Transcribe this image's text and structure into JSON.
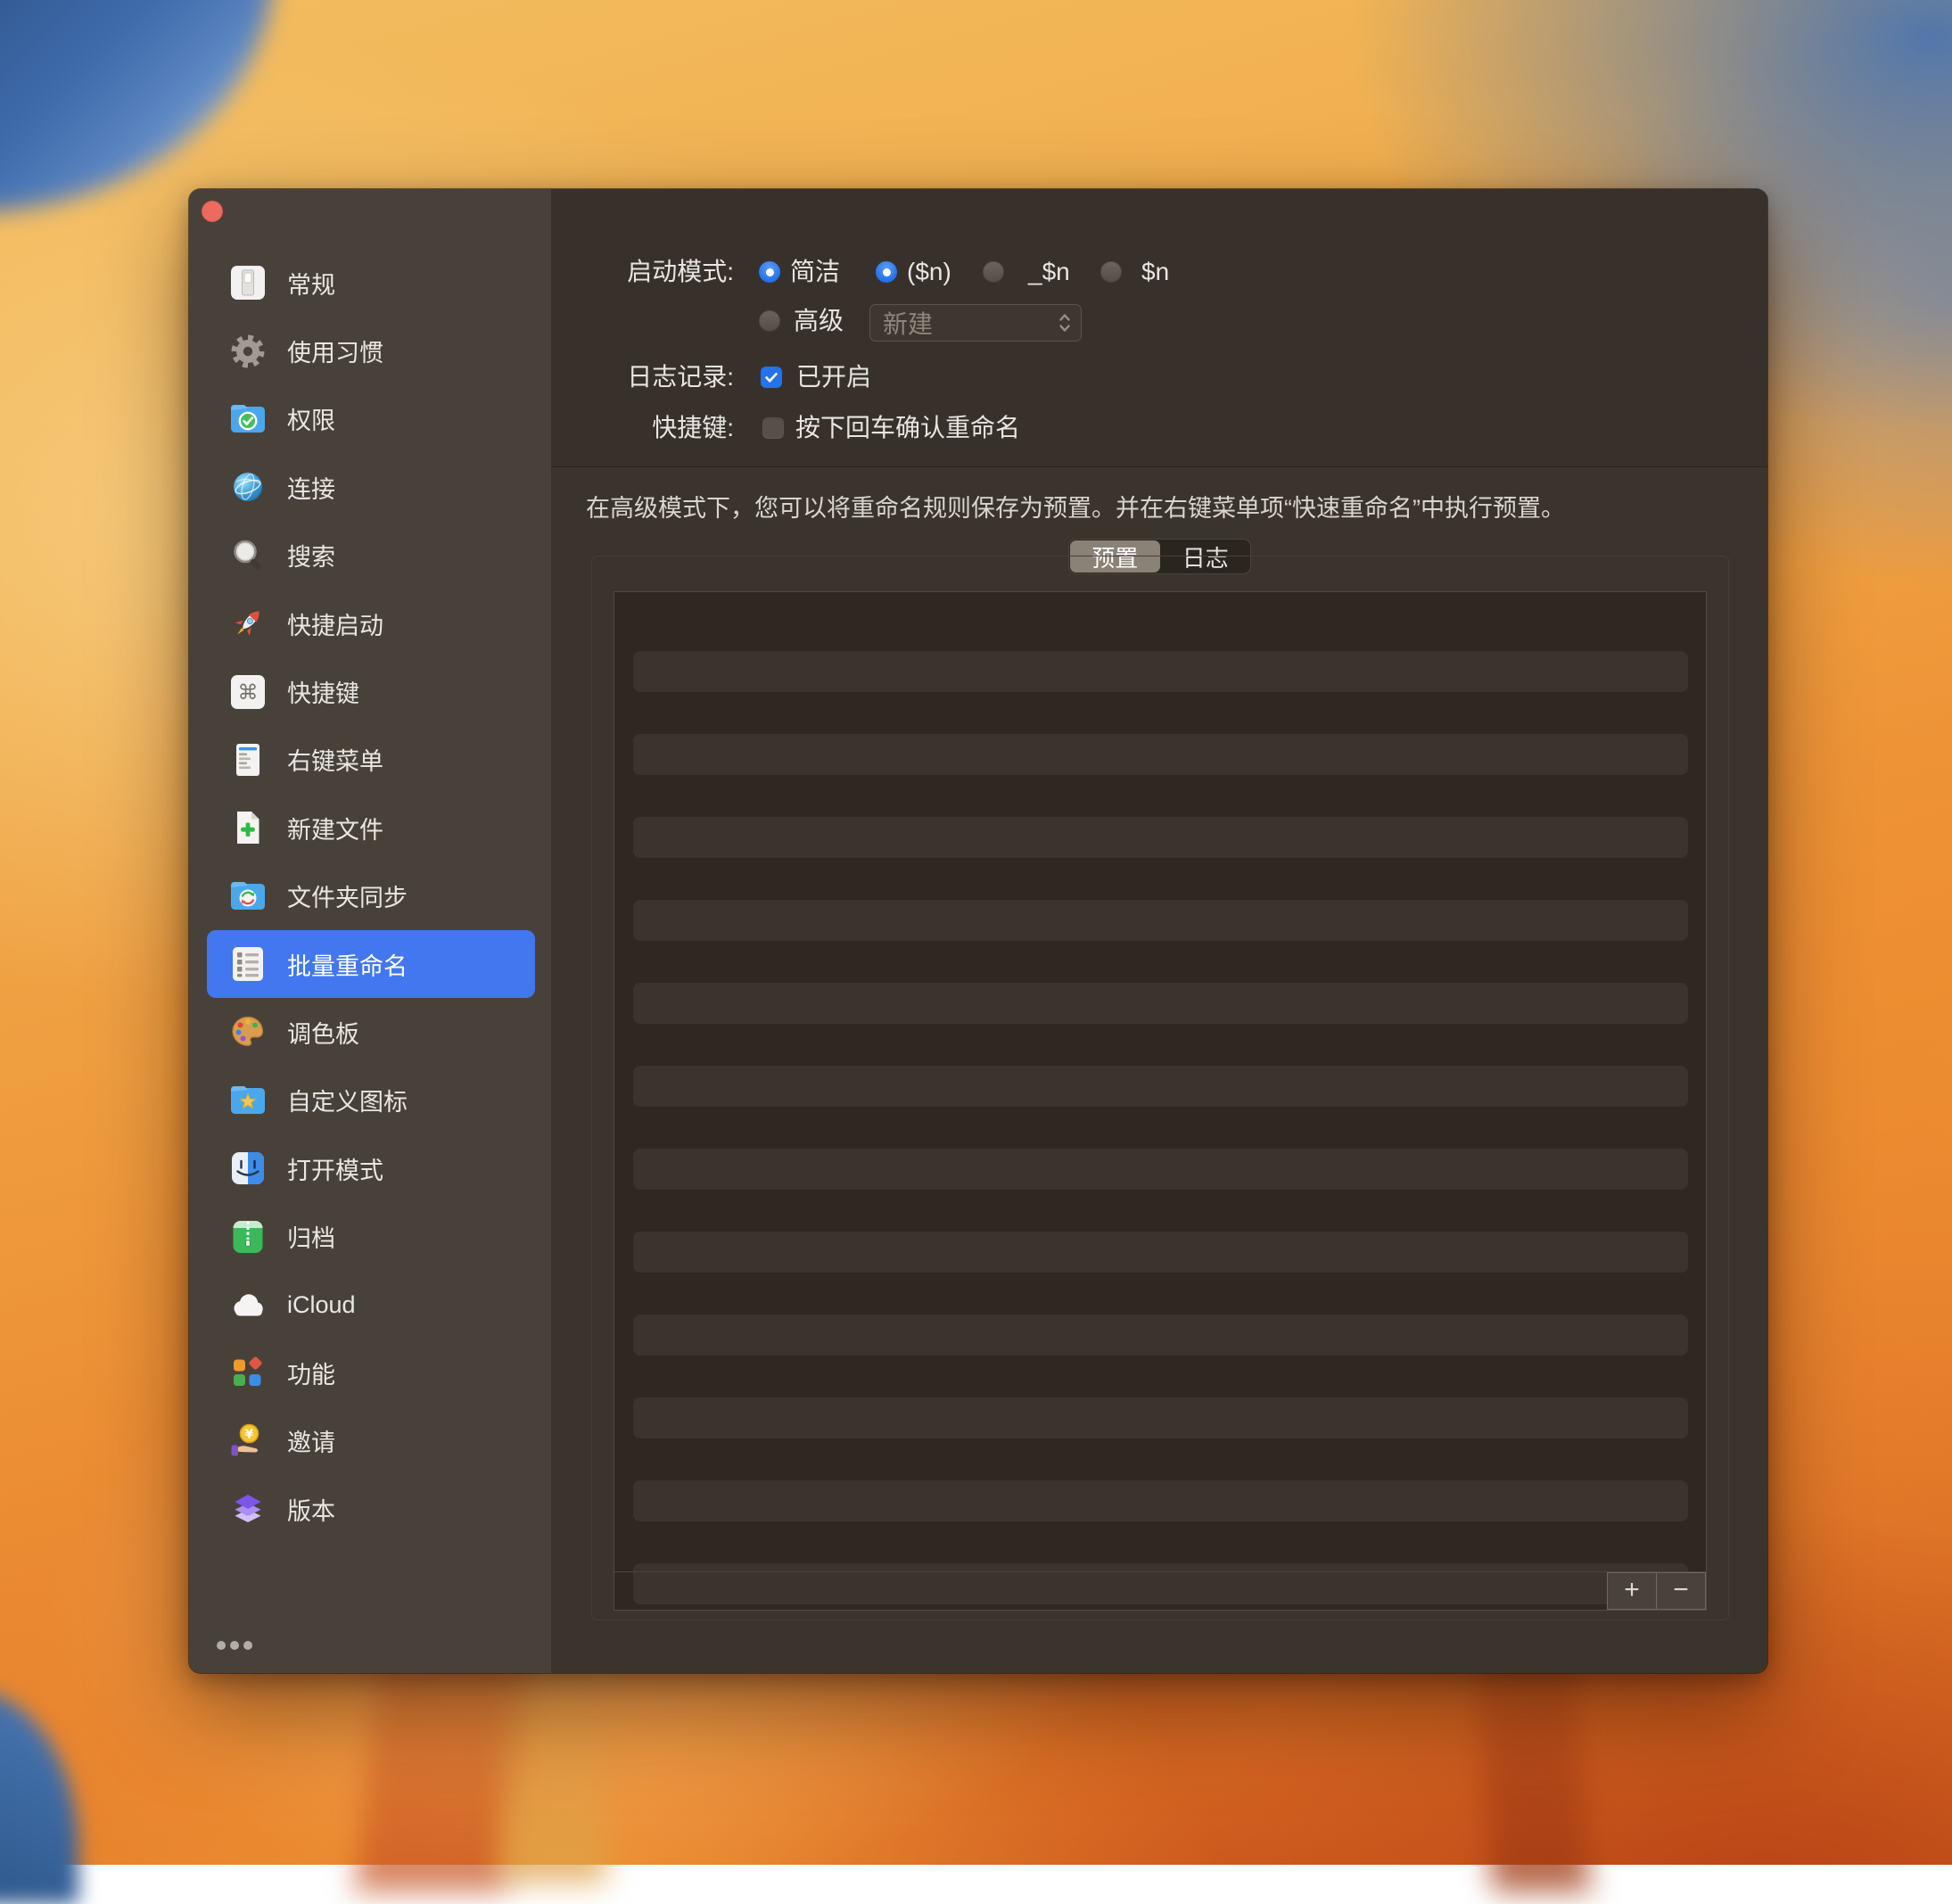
{
  "colors": {
    "accent_blue": "#2273ec",
    "sidebar_selection_blue": "#4377f0",
    "window_sidebar_bg": "#48413a",
    "window_main_bg": "#3b342d",
    "table_bg": "#2f2822",
    "table_stripe": "#3b332c"
  },
  "sidebar": {
    "items": [
      {
        "id": "general",
        "label": "常规"
      },
      {
        "id": "habits",
        "label": "使用习惯"
      },
      {
        "id": "permissions",
        "label": "权限"
      },
      {
        "id": "connection",
        "label": "连接"
      },
      {
        "id": "search",
        "label": "搜索"
      },
      {
        "id": "quick-launch",
        "label": "快捷启动"
      },
      {
        "id": "hotkeys",
        "label": "快捷键"
      },
      {
        "id": "context-menu",
        "label": "右键菜单"
      },
      {
        "id": "new-file",
        "label": "新建文件"
      },
      {
        "id": "folder-sync",
        "label": "文件夹同步"
      },
      {
        "id": "batch-rename",
        "label": "批量重命名",
        "selected": true
      },
      {
        "id": "palette",
        "label": "调色板"
      },
      {
        "id": "custom-icons",
        "label": "自定义图标"
      },
      {
        "id": "open-mode",
        "label": "打开模式"
      },
      {
        "id": "archive",
        "label": "归档"
      },
      {
        "id": "icloud",
        "label": "iCloud"
      },
      {
        "id": "features",
        "label": "功能"
      },
      {
        "id": "invite",
        "label": "邀请"
      },
      {
        "id": "version",
        "label": "版本"
      }
    ]
  },
  "settings": {
    "launch_mode_label": "启动模式:",
    "mode_simple": "简洁",
    "fmt_paren": "($n)",
    "fmt_underscore": "_$n",
    "fmt_plain": "$n",
    "mode_advanced": "高级",
    "preset_select_value": "新建",
    "logging_label": "日志记录:",
    "logging_on": "已开启",
    "hotkey_label": "快捷键:",
    "hotkey_option": "按下回车确认重命名"
  },
  "note": "在高级模式下，您可以将重命名规则保存为预置。并在右键菜单项“快速重命名”中执行预置。",
  "tabs": {
    "preset": "预置",
    "log": "日志"
  },
  "table": {
    "visible_row_count": 12
  },
  "footer": {
    "add": "+",
    "remove": "−"
  }
}
